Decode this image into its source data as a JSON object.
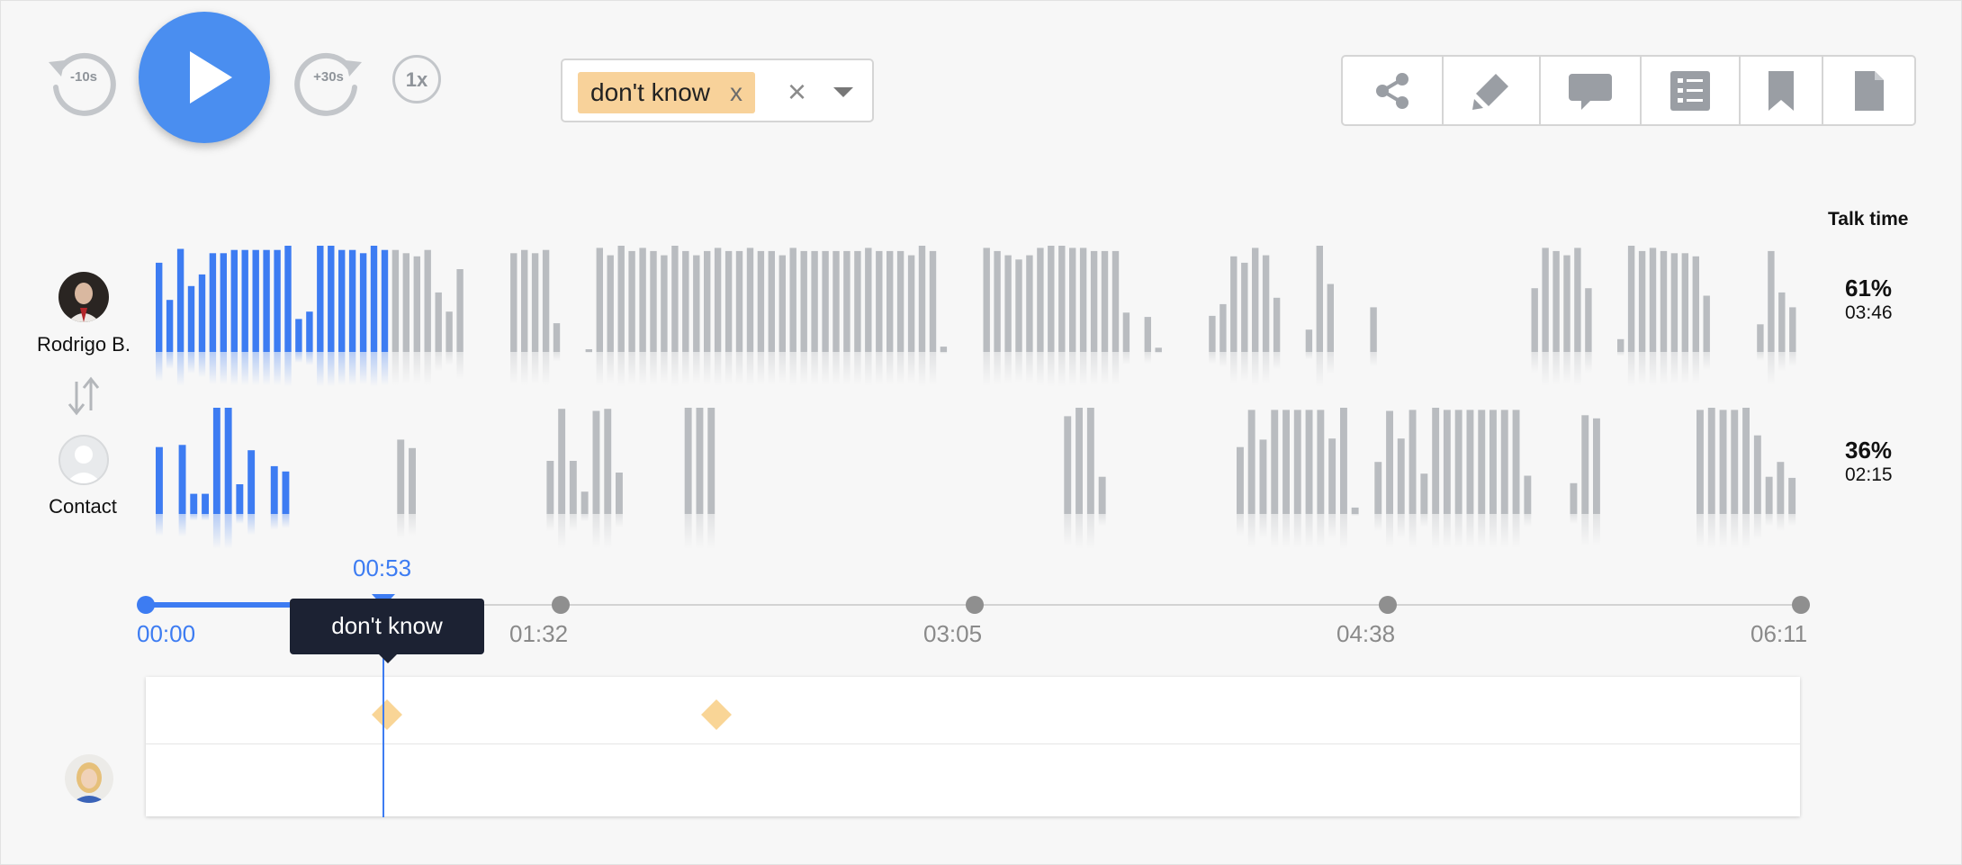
{
  "controls": {
    "rewind_label": "-10s",
    "forward_label": "+30s",
    "speed_label": "1x"
  },
  "filter": {
    "chip_label": "don't know",
    "chip_remove": "x"
  },
  "toolbar": {
    "items": [
      "share-icon",
      "highlighter-icon",
      "comment-icon",
      "checklist-icon",
      "bookmark-icon",
      "document-icon"
    ]
  },
  "talk_time": {
    "header": "Talk time",
    "speakers": [
      {
        "name": "Rodrigo B.",
        "percent": "61%",
        "duration": "03:46"
      },
      {
        "name": "Contact",
        "percent": "36%",
        "duration": "02:15"
      }
    ]
  },
  "timeline": {
    "current_time": "00:53",
    "progress_fraction": 0.144,
    "ticks": [
      "00:00",
      "01:32",
      "03:05",
      "04:38",
      "06:11"
    ],
    "tooltip": "don't know"
  },
  "colors": {
    "accent": "#3d7cf2",
    "bar_played": "#3d7cf2",
    "bar_unplayed": "#b9bcc0",
    "tag": "#f8d29a",
    "tooltip_bg": "#1c2233"
  },
  "waveform": {
    "rodrigo_bar_heights": [
      0.84,
      0.49,
      0.97,
      0.62,
      0.73,
      0.93,
      0.93,
      0.96,
      0.96,
      0.96,
      0.96,
      0.96,
      1.0,
      0.31,
      0.38,
      1.0,
      1.0,
      0.96,
      0.96,
      0.93,
      1.0,
      0.96,
      0.96,
      0.93,
      0.9,
      0.96,
      0.56,
      0.38,
      0.78,
      0.0,
      0.0,
      0.0,
      0.0,
      0.93,
      0.96,
      0.93,
      0.96,
      0.27,
      0.0,
      0.0,
      0.02,
      0.98,
      0.91,
      1.0,
      0.95,
      0.98,
      0.95,
      0.91,
      1.0,
      0.95,
      0.91,
      0.95,
      0.98,
      0.95,
      0.95,
      0.98,
      0.95,
      0.95,
      0.91,
      0.98,
      0.95,
      0.95,
      0.95,
      0.95,
      0.95,
      0.95,
      0.98,
      0.95,
      0.95,
      0.95,
      0.91,
      1.0,
      0.95,
      0.05,
      0.0,
      0.0,
      0.0,
      0.98,
      0.95,
      0.91,
      0.87,
      0.91,
      0.98,
      1.0,
      1.0,
      0.98,
      0.98,
      0.95,
      0.95,
      0.95,
      0.37,
      0.0,
      0.33,
      0.04,
      0.0,
      0.0,
      0.0,
      0.0,
      0.34,
      0.45,
      0.9,
      0.84,
      0.98,
      0.91,
      0.51,
      0.0,
      0.0,
      0.21,
      1.0,
      0.64,
      0.0,
      0.0,
      0.0,
      0.42,
      0.0,
      0.0,
      0.0,
      0.0,
      0.0,
      0.0,
      0.0,
      0.0,
      0.0,
      0.0,
      0.0,
      0.0,
      0.0,
      0.0,
      0.6,
      0.98,
      0.95,
      0.91,
      0.98,
      0.6,
      0.0,
      0.0,
      0.12,
      1.0,
      0.95,
      0.98,
      0.95,
      0.93,
      0.93,
      0.9,
      0.53,
      0.0,
      0.0,
      0.0,
      0.0,
      0.26,
      0.95,
      0.56,
      0.42
    ],
    "contact_bar_heights": [
      0.63,
      0.0,
      0.65,
      0.19,
      0.19,
      1.0,
      1.0,
      0.28,
      0.6,
      0.0,
      0.45,
      0.4,
      0.0,
      0.0,
      0.0,
      0.0,
      0.0,
      0.0,
      0.0,
      0.0,
      0.0,
      0.7,
      0.62,
      0.0,
      0.0,
      0.0,
      0.0,
      0.0,
      0.0,
      0.0,
      0.0,
      0.0,
      0.0,
      0.0,
      0.5,
      0.99,
      0.5,
      0.21,
      0.97,
      0.99,
      0.39,
      0.0,
      0.0,
      0.0,
      0.0,
      0.0,
      1.0,
      1.0,
      1.0,
      0.0,
      0.0,
      0.0,
      0.0,
      0.0,
      0.0,
      0.0,
      0.0,
      0.0,
      0.0,
      0.0,
      0.0,
      0.0,
      0.0,
      0.0,
      0.0,
      0.0,
      0.0,
      0.0,
      0.0,
      0.0,
      0.0,
      0.0,
      0.0,
      0.0,
      0.0,
      0.0,
      0.0,
      0.0,
      0.0,
      0.92,
      1.0,
      1.0,
      0.35,
      0.0,
      0.0,
      0.0,
      0.0,
      0.0,
      0.0,
      0.0,
      0.0,
      0.0,
      0.0,
      0.0,
      0.63,
      0.98,
      0.7,
      0.98,
      0.98,
      0.98,
      0.98,
      0.98,
      0.71,
      1.0,
      0.06,
      0.0,
      0.49,
      0.97,
      0.71,
      0.98,
      0.38,
      1.0,
      0.98,
      0.98,
      0.98,
      0.98,
      0.98,
      0.98,
      0.98,
      0.36,
      0.0,
      0.0,
      0.0,
      0.29,
      0.93,
      0.9,
      0.0,
      0.0,
      0.0,
      0.0,
      0.0,
      0.0,
      0.0,
      0.0,
      0.98,
      1.0,
      0.98,
      0.98,
      1.0,
      0.74,
      0.35,
      0.49,
      0.34
    ]
  }
}
